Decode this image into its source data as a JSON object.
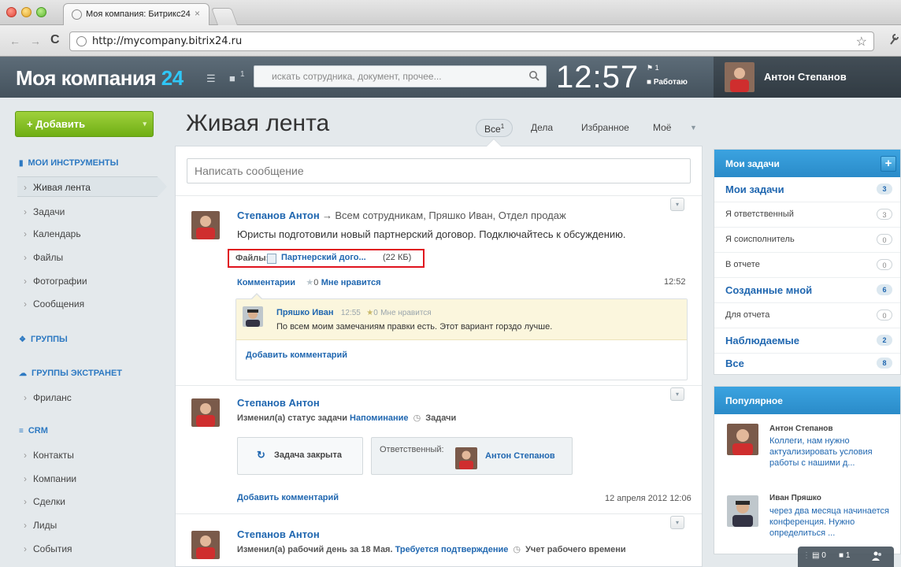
{
  "browser": {
    "tab_title": "Моя компания: Битрикс24",
    "tab_close": "×",
    "url": "http://mycompany.bitrix24.ru",
    "back": "←",
    "forward": "→",
    "reload": "C",
    "star": "☆",
    "wrench": "🔧"
  },
  "header": {
    "logo_text": "Моя компания",
    "logo_num": "24",
    "messages_icon": "☰",
    "notif_icon": "■",
    "notif_count": "1",
    "search_placeholder": "искать сотрудника, документ, прочее...",
    "clock": "12:57",
    "workday_flag": "1",
    "workday_state": "Работаю",
    "user_name": "Антон Степанов"
  },
  "sidebar": {
    "add_button": "+ Добавить",
    "add_caret": "▾",
    "sections": [
      {
        "title": "МОИ ИНСТРУМЕНТЫ",
        "icon": "▮"
      },
      {
        "title": "ГРУППЫ",
        "icon": "❖"
      },
      {
        "title": "ГРУППЫ ЭКСТРАНЕТ",
        "icon": "☁"
      },
      {
        "title": "CRM",
        "icon": "≡"
      }
    ],
    "items": [
      "Живая лента",
      "Задачи",
      "Календарь",
      "Файлы",
      "Фотографии",
      "Сообщения",
      "Фриланс",
      "Контакты",
      "Компании",
      "Сделки",
      "Лиды",
      "События"
    ]
  },
  "main": {
    "title": "Живая лента",
    "filters": {
      "all": "Все",
      "all_count": "1",
      "tasks": "Дела",
      "favorites": "Избранное",
      "mine": "Моё",
      "caret": "▼"
    },
    "compose_placeholder": "Написать сообщение",
    "collapse": "▾",
    "post1": {
      "author": "Степанов Антон",
      "arrow": "→",
      "recipients": "Всем сотрудникам, Пряшко Иван, Отдел продаж",
      "text": "Юристы подготовили новый партнерский договор. Подключайтесь к обсуждению.",
      "files_label": "Файлы:",
      "file_name": "Партнерский дого...",
      "file_size": "(22 КБ)",
      "comments_link": "Комментарии",
      "like_star": "★",
      "like_count": "0",
      "like_label": "Мне нравится",
      "time": "12:52",
      "comment": {
        "author": "Пряшко Иван",
        "time": "12:55",
        "like_star": "★",
        "like_count": "0",
        "like_label": "Мне нравится",
        "text": "По всем моим замечаниям правки есть. Этот вариант горздо лучше."
      },
      "add_comment": "Добавить комментарий"
    },
    "post2": {
      "author": "Степанов Антон",
      "action": "Изменил(а) статус задачи",
      "task_link": "Напоминание",
      "clock_icon": "◷",
      "section": "Задачи",
      "closed_icon": "↻",
      "closed_label": "Задача закрыта",
      "resp_label": "Ответственный:",
      "resp_name": "Антон Степанов",
      "add_comment": "Добавить комментарий",
      "date": "12 апреля 2012 12:06"
    },
    "post3": {
      "author": "Степанов Антон",
      "action": "Изменил(а) рабочий день за 18 Мая.",
      "link": "Требуется подтверждение",
      "clock_icon": "◷",
      "section": "Учет рабочего времени"
    }
  },
  "tasks_panel": {
    "title": "Мои задачи",
    "plus": "+",
    "rows": [
      {
        "label": "Мои задачи",
        "count": "3",
        "bold": true
      },
      {
        "label": "Я ответственный",
        "count": "3",
        "bold": false
      },
      {
        "label": "Я соисполнитель",
        "count": "0",
        "bold": false
      },
      {
        "label": "В отчете",
        "count": "0",
        "bold": false
      },
      {
        "label": "Созданные мной",
        "count": "6",
        "bold": true
      },
      {
        "label": "Для отчета",
        "count": "0",
        "bold": false
      },
      {
        "label": "Наблюдаемые",
        "count": "2",
        "bold": true
      },
      {
        "label": "Все",
        "count": "8",
        "bold": true
      }
    ]
  },
  "popular_panel": {
    "title": "Популярное",
    "items": [
      {
        "name": "Антон Степанов",
        "lines": [
          "Коллеги, нам нужно",
          "актуализировать условия",
          "работы с нашими д..."
        ]
      },
      {
        "name": "Иван Пряшко",
        "lines": [
          "через два месяца начинается",
          "конференция. Нужно",
          "определиться ..."
        ]
      }
    ]
  },
  "bottom_bar": {
    "messages_count": "0",
    "notif_count": "1"
  },
  "colors": {
    "accent_blue": "#2067b0",
    "header_bg": "#4e5c67",
    "add_green": "#83bf22",
    "highlight_red": "#e0131e",
    "panel_blue": "#2f93d0"
  }
}
